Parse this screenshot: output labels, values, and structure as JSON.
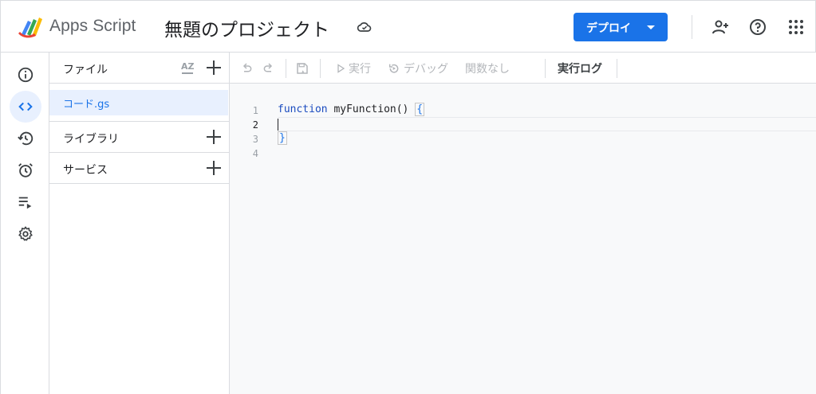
{
  "header": {
    "app_name": "Apps Script",
    "project_title": "無題のプロジェクト",
    "deploy_label": "デプロイ"
  },
  "files_panel": {
    "files_label": "ファイル",
    "sort_label": "AZ",
    "files": [
      {
        "name": "コード.gs"
      }
    ],
    "libraries_label": "ライブラリ",
    "services_label": "サービス"
  },
  "toolbar": {
    "run_label": "実行",
    "debug_label": "デバッグ",
    "function_select": "関数なし",
    "exec_log_label": "実行ログ"
  },
  "editor": {
    "line_numbers": [
      "1",
      "2",
      "3",
      "4"
    ],
    "keyword": "function",
    "function_name": "myFunction",
    "parens": "()",
    "open_brace": "{",
    "close_brace": "}"
  },
  "colors": {
    "accent": "#1a73e8",
    "active_bg": "#e8f0fe",
    "border": "#dadce0",
    "disabled": "#b3b6ba"
  }
}
